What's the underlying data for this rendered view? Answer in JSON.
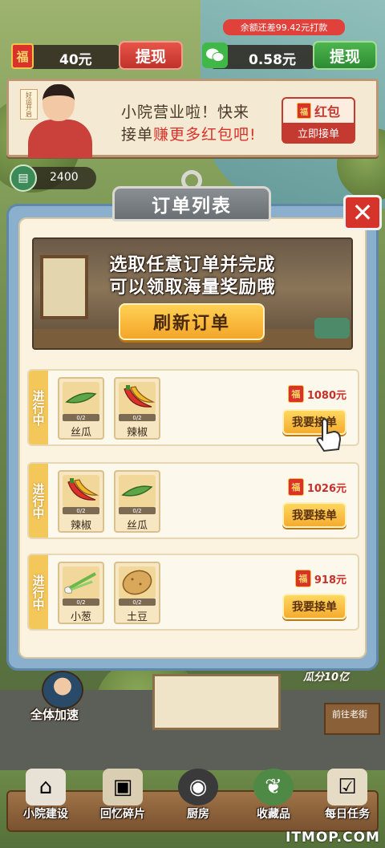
{
  "topbar": {
    "fu_char": "福",
    "cash_amount": "40元",
    "withdraw_label": "提现",
    "balance_note": "余额还差99.42元打款",
    "wechat_amount": "0.58元",
    "wechat_withdraw_label": "提现"
  },
  "banner": {
    "tag": "好运开启",
    "line1": "小院营业啦！快来",
    "line2_prefix": "接单",
    "line2_highlight": "赚更多红包吧!",
    "hongbao_label": "红包",
    "hongbao_action": "立即接单"
  },
  "coins": {
    "value": "2400"
  },
  "panel": {
    "title": "订单列表",
    "close_icon": "✕",
    "promo_line1": "选取任意订单并完成",
    "promo_line2": "可以领取海量奖励哦",
    "refresh_label": "刷新订单"
  },
  "orders": [
    {
      "status": "进行中",
      "items": [
        {
          "name": "丝瓜",
          "progress": "0/2",
          "icon": "loofah-icon"
        },
        {
          "name": "辣椒",
          "progress": "0/2",
          "icon": "chili-icon"
        }
      ],
      "reward": "1080元",
      "action": "我要接单"
    },
    {
      "status": "进行中",
      "items": [
        {
          "name": "辣椒",
          "progress": "0/2",
          "icon": "chili-icon"
        },
        {
          "name": "丝瓜",
          "progress": "0/2",
          "icon": "loofah-icon"
        }
      ],
      "reward": "1026元",
      "action": "我要接单"
    },
    {
      "status": "进行中",
      "items": [
        {
          "name": "小葱",
          "progress": "0/2",
          "icon": "scallion-icon"
        },
        {
          "name": "土豆",
          "progress": "0/2",
          "icon": "potato-icon"
        }
      ],
      "reward": "918元",
      "action": "我要接单"
    }
  ],
  "hud": {
    "speed_label": "全体加速",
    "gua_tag": "瓜分10亿",
    "sign_label": "前往老街"
  },
  "nav": [
    {
      "label": "小院建设",
      "icon": "house-icon"
    },
    {
      "label": "回忆碎片",
      "icon": "photo-icon"
    },
    {
      "label": "厨房",
      "icon": "wok-icon"
    },
    {
      "label": "收藏品",
      "icon": "frog-icon"
    },
    {
      "label": "每日任务",
      "icon": "checklist-icon"
    }
  ],
  "watermark": "ITMOP.COM",
  "colors": {
    "accent_red": "#d8322a",
    "accent_gold": "#f3c75a",
    "panel_blue": "#8ab0cd",
    "wechat_green": "#3fb847"
  }
}
